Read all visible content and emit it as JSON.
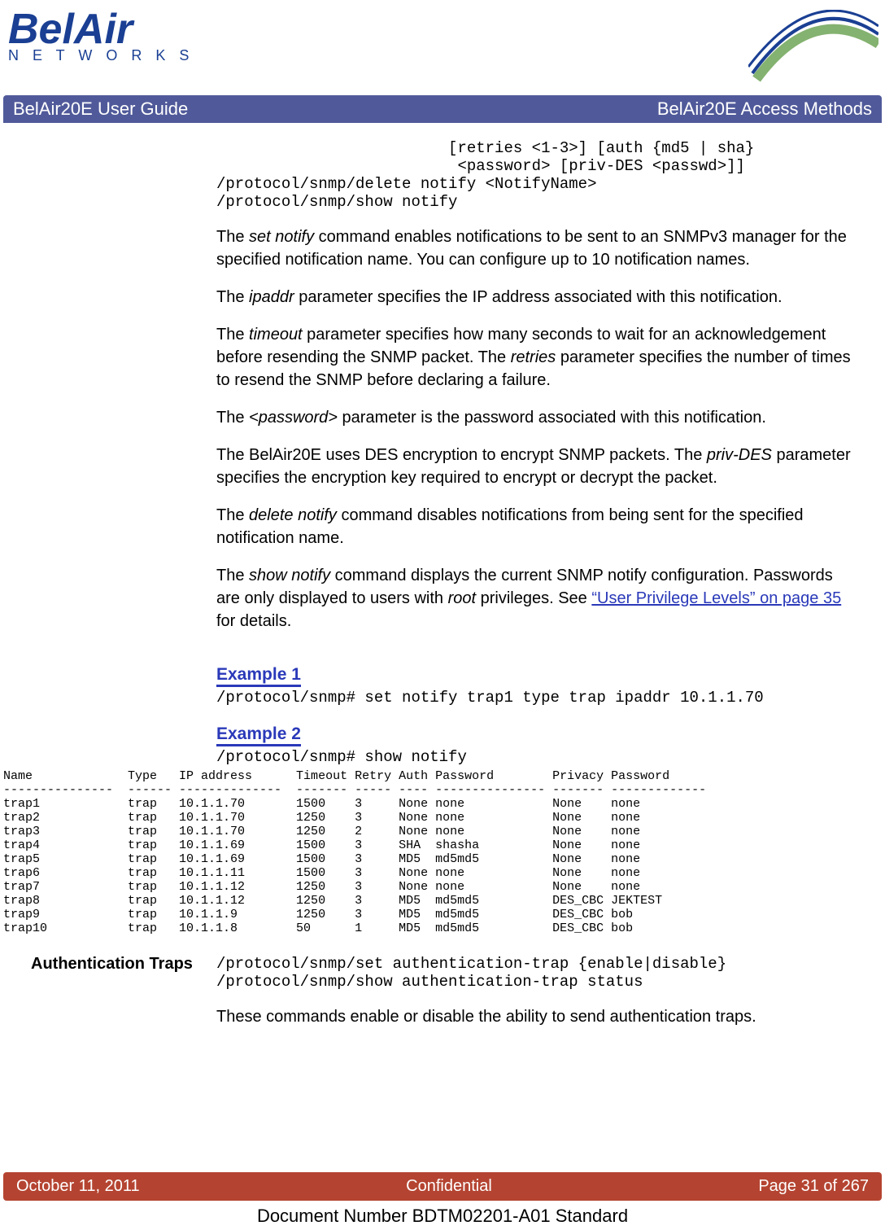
{
  "logo": {
    "big": "BelAir",
    "sub": "N E T W O R K S"
  },
  "banner": {
    "left": "BelAir20E User Guide",
    "right": "BelAir20E Access Methods"
  },
  "code_top": "                         [retries <1-3>] [auth {md5 | sha}\n                          <password> [priv-DES <passwd>]]\n/protocol/snmp/delete notify <NotifyName>\n/protocol/snmp/show notify",
  "p1_a": "The ",
  "p1_b": "set notify",
  "p1_c": " command enables notifications to be sent to an SNMPv3 manager for the specified notification name. You can configure up to 10 notification names.",
  "p2_a": "The ",
  "p2_b": "ipaddr",
  "p2_c": " parameter specifies the IP address associated with this notification.",
  "p3_a": "The ",
  "p3_b": "timeout",
  "p3_c": " parameter specifies how many seconds to wait for an acknowledgement before resending the SNMP packet. The ",
  "p3_d": "retries",
  "p3_e": " parameter specifies the number of times to resend the SNMP before declaring a failure.",
  "p4_a": "The ",
  "p4_b": "<password>",
  "p4_c": " parameter is the password associated with this notification.",
  "p5_a": "The BelAir20E uses DES encryption to encrypt SNMP packets. The ",
  "p5_b": "priv-DES",
  "p5_c": " parameter specifies the encryption key required to encrypt or decrypt the packet.",
  "p6_a": "The ",
  "p6_b": "delete notify",
  "p6_c": " command disables notifications from being sent for the specified notification name.",
  "p7_a": "The ",
  "p7_b": "show notify",
  "p7_c": " command displays the current SNMP notify configuration. Passwords are only displayed to users with ",
  "p7_d": "root",
  "p7_e": " privileges. See ",
  "p7_link": "“User Privilege Levels” on page 35",
  "p7_f": " for details.",
  "ex1_h": "Example 1",
  "ex1_code": "/protocol/snmp# set notify trap1 type trap ipaddr 10.1.1.70",
  "ex2_h": "Example 2",
  "ex2_code": "/protocol/snmp# show notify",
  "table": "Name             Type   IP address      Timeout Retry Auth Password        Privacy Password\n---------------  ------ --------------  ------- ----- ---- --------------- ------- -------------\ntrap1            trap   10.1.1.70       1500    3     None none            None    none\ntrap2            trap   10.1.1.70       1250    3     None none            None    none\ntrap3            trap   10.1.1.70       1250    2     None none            None    none\ntrap4            trap   10.1.1.69       1500    3     SHA  shasha          None    none\ntrap5            trap   10.1.1.69       1500    3     MD5  md5md5          None    none\ntrap6            trap   10.1.1.11       1500    3     None none            None    none\ntrap7            trap   10.1.1.12       1250    3     None none            None    none\ntrap8            trap   10.1.1.12       1250    3     MD5  md5md5          DES_CBC JEKTEST\ntrap9            trap   10.1.1.9        1250    3     MD5  md5md5          DES_CBC bob\ntrap10           trap   10.1.1.8        50      1     MD5  md5md5          DES_CBC bob",
  "auth_heading": "Authentication Traps",
  "auth_code": "/protocol/snmp/set authentication-trap {enable|disable}\n/protocol/snmp/show authentication-trap status",
  "auth_text": "These commands enable or disable the ability to send authentication traps.",
  "footer": {
    "left": "October 11, 2011",
    "center": "Confidential",
    "right": "Page 31 of 267"
  },
  "docnum": "Document Number BDTM02201-A01 Standard"
}
